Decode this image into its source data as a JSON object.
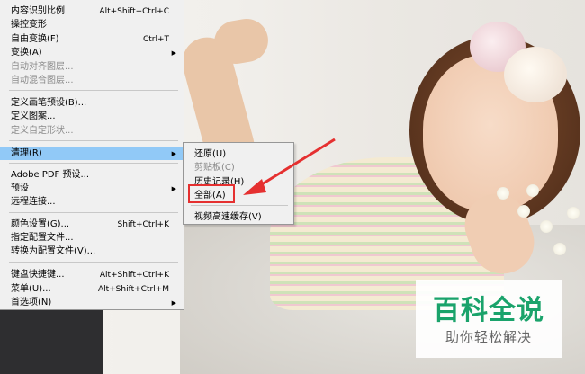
{
  "menu": {
    "items": [
      {
        "label": "内容识别比例",
        "shortcut": "Alt+Shift+Ctrl+C",
        "disabled": false,
        "submenu": false
      },
      {
        "label": "操控变形",
        "shortcut": "",
        "disabled": false,
        "submenu": false
      },
      {
        "label": "自由变换(F)",
        "shortcut": "Ctrl+T",
        "disabled": false,
        "submenu": false
      },
      {
        "label": "变换(A)",
        "shortcut": "",
        "disabled": false,
        "submenu": true
      },
      {
        "label": "自动对齐图层...",
        "shortcut": "",
        "disabled": true,
        "submenu": false
      },
      {
        "label": "自动混合图层...",
        "shortcut": "",
        "disabled": true,
        "submenu": false
      },
      {
        "label": "定义画笔预设(B)...",
        "shortcut": "",
        "disabled": false,
        "submenu": false
      },
      {
        "label": "定义图案...",
        "shortcut": "",
        "disabled": false,
        "submenu": false
      },
      {
        "label": "定义自定形状...",
        "shortcut": "",
        "disabled": true,
        "submenu": false
      },
      {
        "label": "清理(R)",
        "shortcut": "",
        "disabled": false,
        "submenu": true,
        "active": true
      },
      {
        "label": "Adobe PDF 预设...",
        "shortcut": "",
        "disabled": false,
        "submenu": false
      },
      {
        "label": "预设",
        "shortcut": "",
        "disabled": false,
        "submenu": true
      },
      {
        "label": "远程连接...",
        "shortcut": "",
        "disabled": false,
        "submenu": false
      },
      {
        "label": "颜色设置(G)...",
        "shortcut": "Shift+Ctrl+K",
        "disabled": false,
        "submenu": false
      },
      {
        "label": "指定配置文件...",
        "shortcut": "",
        "disabled": false,
        "submenu": false
      },
      {
        "label": "转换为配置文件(V)...",
        "shortcut": "",
        "disabled": false,
        "submenu": false
      },
      {
        "label": "键盘快捷键...",
        "shortcut": "Alt+Shift+Ctrl+K",
        "disabled": false,
        "submenu": false
      },
      {
        "label": "菜单(U)...",
        "shortcut": "Alt+Shift+Ctrl+M",
        "disabled": false,
        "submenu": false
      },
      {
        "label": "首选项(N)",
        "shortcut": "",
        "disabled": false,
        "submenu": true
      }
    ]
  },
  "submenu": {
    "items": [
      {
        "label": "还原(U)",
        "disabled": false
      },
      {
        "label": "剪贴板(C)",
        "disabled": true
      },
      {
        "label": "历史记录(H)",
        "disabled": false
      },
      {
        "label": "全部(A)",
        "disabled": false,
        "highlighted": true
      },
      {
        "label": "视频高速缓存(V)",
        "disabled": false
      }
    ]
  },
  "watermark": {
    "title": "百科全说",
    "subtitle": "助你轻松解决"
  },
  "colors": {
    "menu_bg": "#f0f0f0",
    "active_item": "#91c9f7",
    "highlight_box": "#e53030",
    "watermark_green": "#1aa36b"
  }
}
